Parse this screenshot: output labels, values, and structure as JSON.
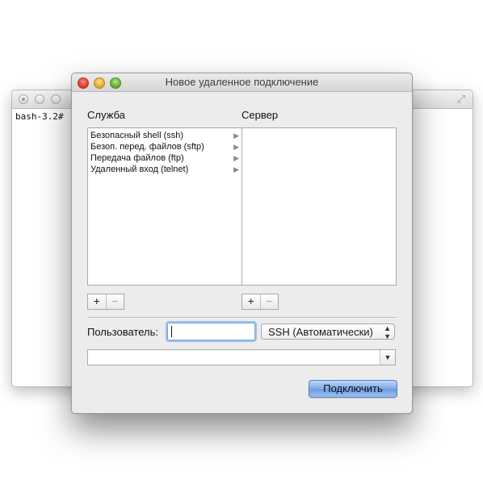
{
  "terminal": {
    "prompt": "bash-3.2#",
    "fullscreen_icon": "⤢"
  },
  "dialog": {
    "title": "Новое удаленное подключение",
    "service_header": "Служба",
    "server_header": "Сервер",
    "services": [
      {
        "label": "Безопасный shell (ssh)"
      },
      {
        "label": "Безоп. перед. файлов (sftp)"
      },
      {
        "label": "Передача файлов (ftp)"
      },
      {
        "label": "Удаленный вход (telnet)"
      }
    ],
    "add_symbol": "+",
    "remove_symbol": "−",
    "user_label": "Пользователь:",
    "user_value": "",
    "protocol_value": "SSH (Автоматически)",
    "command_value": "",
    "connect_label": "Подключить"
  },
  "colors": {
    "accent_button": "#7fa9e6",
    "focus_ring": "#9cc2ee"
  }
}
